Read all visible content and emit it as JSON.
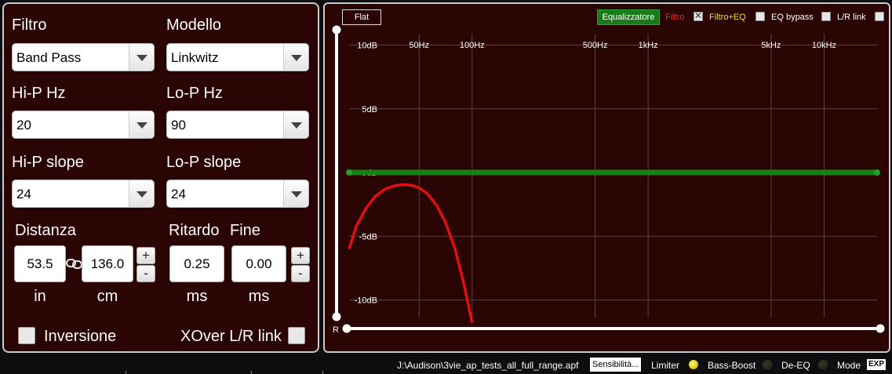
{
  "filter": {
    "filtro_label": "Filtro",
    "filtro_value": "Band Pass",
    "modello_label": "Modello",
    "modello_value": "Linkwitz",
    "hip_hz_label": "Hi-P Hz",
    "hip_hz_value": "20",
    "lop_hz_label": "Lo-P Hz",
    "lop_hz_value": "90",
    "hip_slope_label": "Hi-P slope",
    "hip_slope_value": "24",
    "lop_slope_label": "Lo-P slope",
    "lop_slope_value": "24"
  },
  "delay": {
    "distanza_label": "Distanza",
    "distanza_in": "53.5",
    "distanza_cm": "136.0",
    "unit_in": "in",
    "unit_cm": "cm",
    "ritardo_label": "Ritardo",
    "ritardo_value": "0.25",
    "fine_label": "Fine",
    "fine_value": "0.00",
    "unit_ms": "ms",
    "plus": "+",
    "minus": "-"
  },
  "options": {
    "inversione_label": "Inversione",
    "inversione_checked": false,
    "xover_link_label": "XOver L/R link",
    "xover_link_checked": false
  },
  "graph": {
    "flat_label": "Flat",
    "equalizer_label": "Equalizzatore",
    "filtro_legend": "Filtro",
    "filtro_checked": true,
    "filtro_eq_legend": "Filtro+EQ",
    "filtro_eq_checked": false,
    "eq_bypass_label": "EQ bypass",
    "eq_bypass_checked": false,
    "lr_link_label": "L/R link",
    "lr_link_checked": false,
    "freq_labels": [
      "50Hz",
      "100Hz",
      "500Hz",
      "1kHz",
      "5kHz",
      "10kHz"
    ],
    "db_labels": [
      "10dB",
      "5dB",
      "0dB",
      "-5dB",
      "-10dB"
    ],
    "r_label": "R",
    "colors": {
      "eq_line": "#168216",
      "filter_curve": "#e01010",
      "filter_eq_text": "#e8e800"
    }
  },
  "chart_data": {
    "type": "line",
    "xscale": "log",
    "xlim": [
      20,
      20000
    ],
    "ylim": [
      -12,
      12
    ],
    "xticks": [
      "50Hz",
      "100Hz",
      "500Hz",
      "1kHz",
      "5kHz",
      "10kHz"
    ],
    "yticks": [
      "10dB",
      "5dB",
      "0dB",
      "-5dB",
      "-10dB"
    ],
    "grid": true,
    "series": [
      {
        "name": "Equalizzatore",
        "color": "#168216",
        "x": [
          20,
          20000
        ],
        "y": [
          0,
          0
        ]
      },
      {
        "name": "Filtro",
        "color": "#e01010",
        "x": [
          20,
          22,
          25,
          28,
          32,
          36,
          40,
          45,
          50,
          56,
          63,
          70,
          80,
          90,
          100
        ],
        "y": [
          -6.0,
          -4.2,
          -2.8,
          -1.9,
          -1.3,
          -1.05,
          -0.95,
          -1.0,
          -1.2,
          -1.7,
          -2.6,
          -3.8,
          -6.0,
          -8.8,
          -11.8
        ]
      }
    ]
  },
  "status": {
    "file_path": "J:\\Audison\\3vie_ap_tests_all_full_range.apf",
    "sensibilita_label": "Sensibilità...",
    "limiter_label": "Limiter",
    "limiter_on": true,
    "bass_boost_label": "Bass-Boost",
    "bass_boost_on": false,
    "de_eq_label": "De-EQ",
    "de_eq_on": false,
    "mode_label": "Mode",
    "exp_label": "EXP"
  }
}
